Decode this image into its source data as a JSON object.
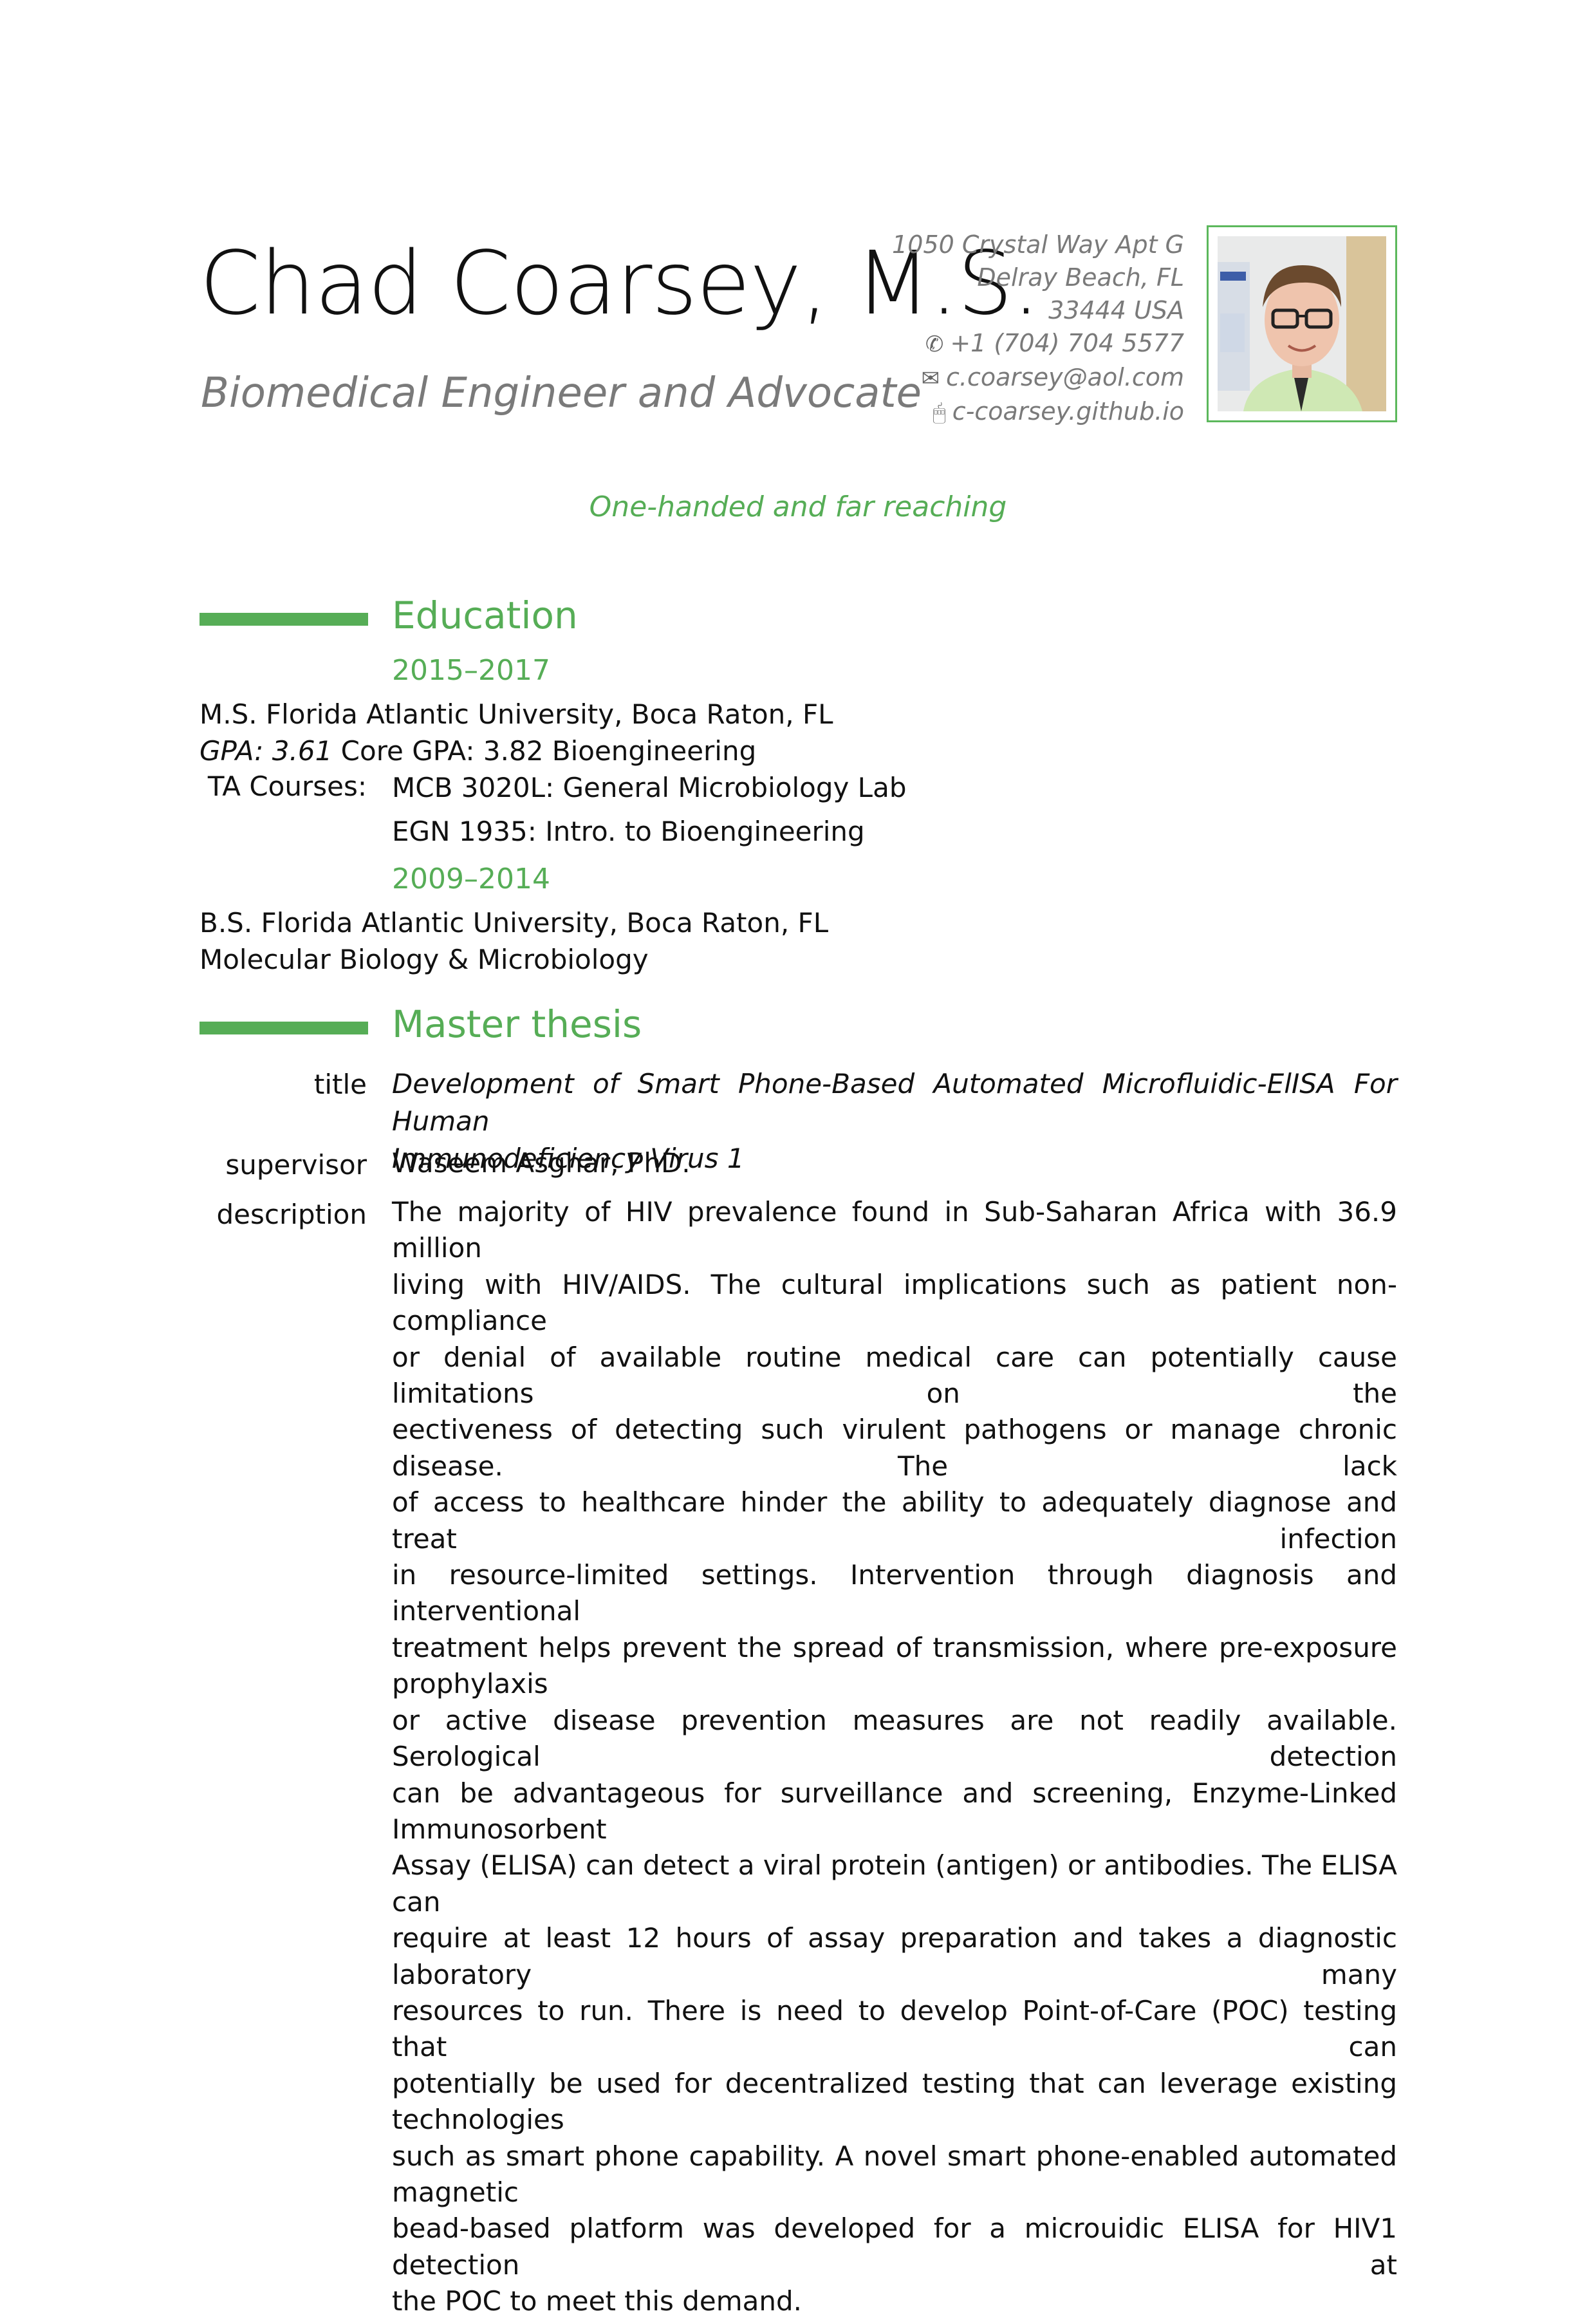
{
  "header": {
    "name": "Chad Coarsey, M.S.",
    "subtitle": "Biomedical Engineer and Advocate",
    "address": [
      "1050 Crystal Way Apt G",
      "Delray Beach, FL",
      "33444 USA"
    ],
    "phone": "+1 (704) 704 5577",
    "email": "c.coarsey@aol.com",
    "website": "c-coarsey.github.io",
    "icons": {
      "phone": "phone-icon",
      "email": "envelope-icon",
      "website": "mouse-icon"
    },
    "quote": "One-handed and far reaching"
  },
  "colors": {
    "accent": "#56ad56",
    "muted": "#7a7a7a",
    "text": "#111111"
  },
  "education": {
    "title": "Education",
    "entries": [
      {
        "dates": "2015–2017",
        "line1": "M.S. Florida Atlantic University, Boca Raton, FL",
        "gpa": "GPA: 3.61",
        "gpa_rest": "Core GPA: 3.82 Bioengineering",
        "ta_label": "TA Courses:",
        "courses": [
          "MCB 3020L: General Microbiology Lab",
          "EGN 1935: Intro. to Bioengineering"
        ]
      },
      {
        "dates": "2009–2014",
        "line1": "B.S. Florida Atlantic University, Boca Raton, FL",
        "line2": "Molecular Biology & Microbiology"
      }
    ]
  },
  "thesis": {
    "title": "Master thesis",
    "title_label": "title",
    "title_lines": [
      "Development of Smart Phone-Based Automated Microfluidic-ElISA For Human",
      "Immunodeficiency Virus 1"
    ],
    "supervisor_label": "supervisor",
    "supervisor": "Waseem Asghar, PhD.",
    "description_label": "description",
    "description_lines": [
      "The majority of HIV prevalence found in Sub-Saharan Africa with 36.9 million",
      "living with HIV/AIDS. The cultural implications such as patient non-compliance",
      "or denial of available routine medical care can potentially cause limitations on the",
      "eectiveness of detecting such virulent pathogens or manage chronic disease. The lack",
      "of access to healthcare hinder the ability to adequately diagnose and treat infection",
      "in resource-limited settings. Intervention through diagnosis and interventional",
      "treatment helps prevent the spread of transmission, where pre-exposure prophylaxis",
      "or active disease prevention measures are not readily available. Serological detection",
      "can be advantageous for surveillance and screening, Enzyme-Linked Immunosorbent",
      "Assay (ELISA) can detect a viral protein (antigen) or antibodies. The ELISA can",
      "require at least 12 hours of assay preparation and takes a diagnostic laboratory many",
      "resources to run. There is need to develop Point-of-Care (POC) testing that can",
      "potentially be used for decentralized testing that can leverage existing technologies",
      "such as smart phone capability. A novel smart phone-enabled automated magnetic",
      "bead-based platform was developed for a microuidic ELISA for HIV1 detection at",
      "the POC to meet this demand."
    ]
  }
}
